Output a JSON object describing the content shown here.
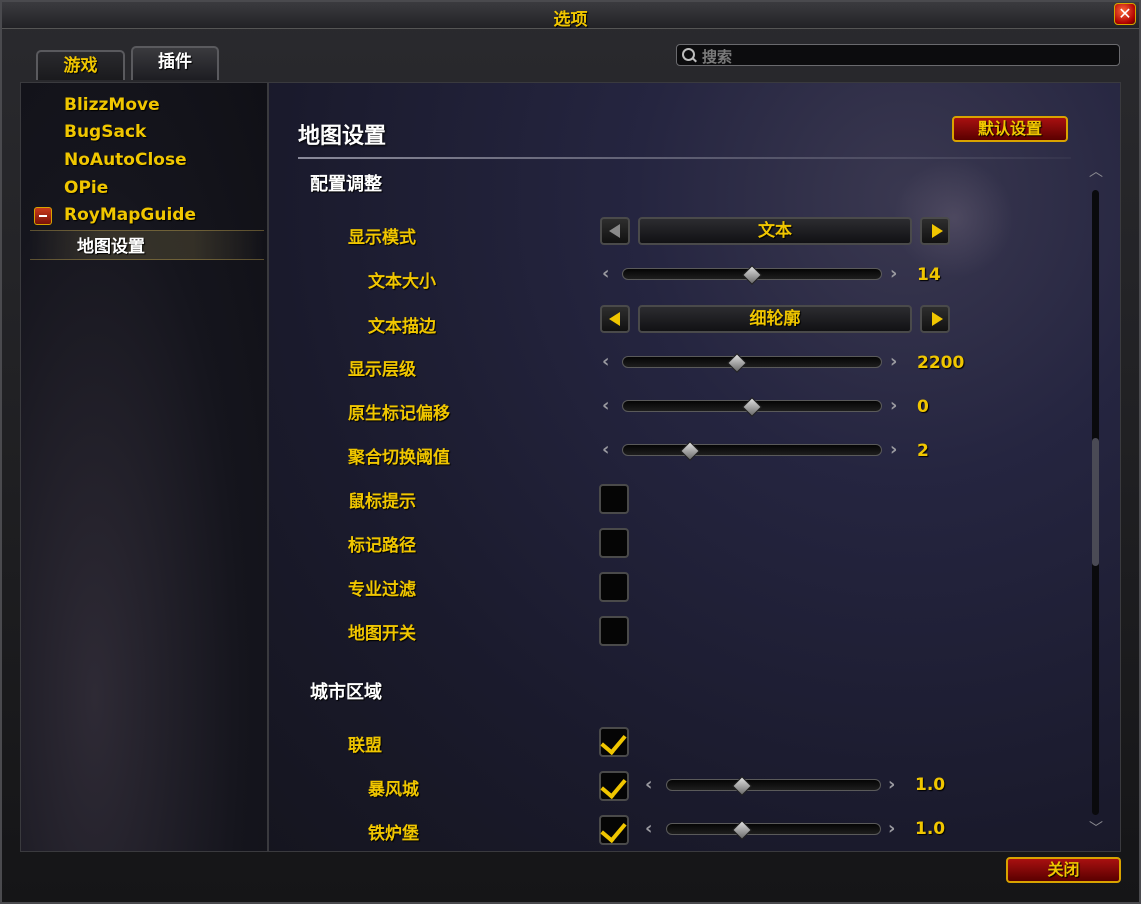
{
  "window": {
    "title": "选项"
  },
  "tabs": [
    {
      "label": "游戏"
    },
    {
      "label": "插件"
    }
  ],
  "search": {
    "placeholder": "搜索"
  },
  "sidebar": {
    "items": [
      {
        "label": "BlizzMove"
      },
      {
        "label": "BugSack"
      },
      {
        "label": "NoAutoClose"
      },
      {
        "label": "OPie"
      },
      {
        "label": "RoyMapGuide"
      }
    ],
    "selected_sub": {
      "label": "地图设置"
    }
  },
  "panel": {
    "title": "地图设置",
    "defaults_button": "默认设置",
    "sections": [
      {
        "header": "配置调整",
        "rows": [
          {
            "label": "显示模式",
            "type": "dropdown",
            "value": "文本"
          },
          {
            "label": "文本大小",
            "type": "slider",
            "value": "14",
            "fraction": 0.5
          },
          {
            "label": "文本描边",
            "type": "dropdown",
            "value": "细轮廓"
          },
          {
            "label": "显示层级",
            "type": "slider",
            "value": "2200",
            "fraction": 0.44
          },
          {
            "label": "原生标记偏移",
            "type": "slider",
            "value": "0",
            "fraction": 0.5
          },
          {
            "label": "聚合切换阈值",
            "type": "slider",
            "value": "2",
            "fraction": 0.26
          },
          {
            "label": "鼠标提示",
            "type": "checkbox",
            "checked": false
          },
          {
            "label": "标记路径",
            "type": "checkbox",
            "checked": false
          },
          {
            "label": "专业过滤",
            "type": "checkbox",
            "checked": false
          },
          {
            "label": "地图开关",
            "type": "checkbox",
            "checked": false
          }
        ]
      },
      {
        "header": "城市区域",
        "rows": [
          {
            "label": "联盟",
            "type": "checkbox",
            "checked": true
          },
          {
            "label": "暴风城",
            "type": "check-slider",
            "checked": true,
            "value": "1.0",
            "fraction": 0.35
          },
          {
            "label": "铁炉堡",
            "type": "check-slider",
            "checked": true,
            "value": "1.0",
            "fraction": 0.35
          }
        ]
      }
    ]
  },
  "footer": {
    "close_button": "关闭"
  },
  "colors": {
    "gold": "#f0c600",
    "red_button": "#a81010"
  },
  "icons": {
    "close": "close-icon",
    "search": "search-icon",
    "collapse": "minus-icon"
  }
}
